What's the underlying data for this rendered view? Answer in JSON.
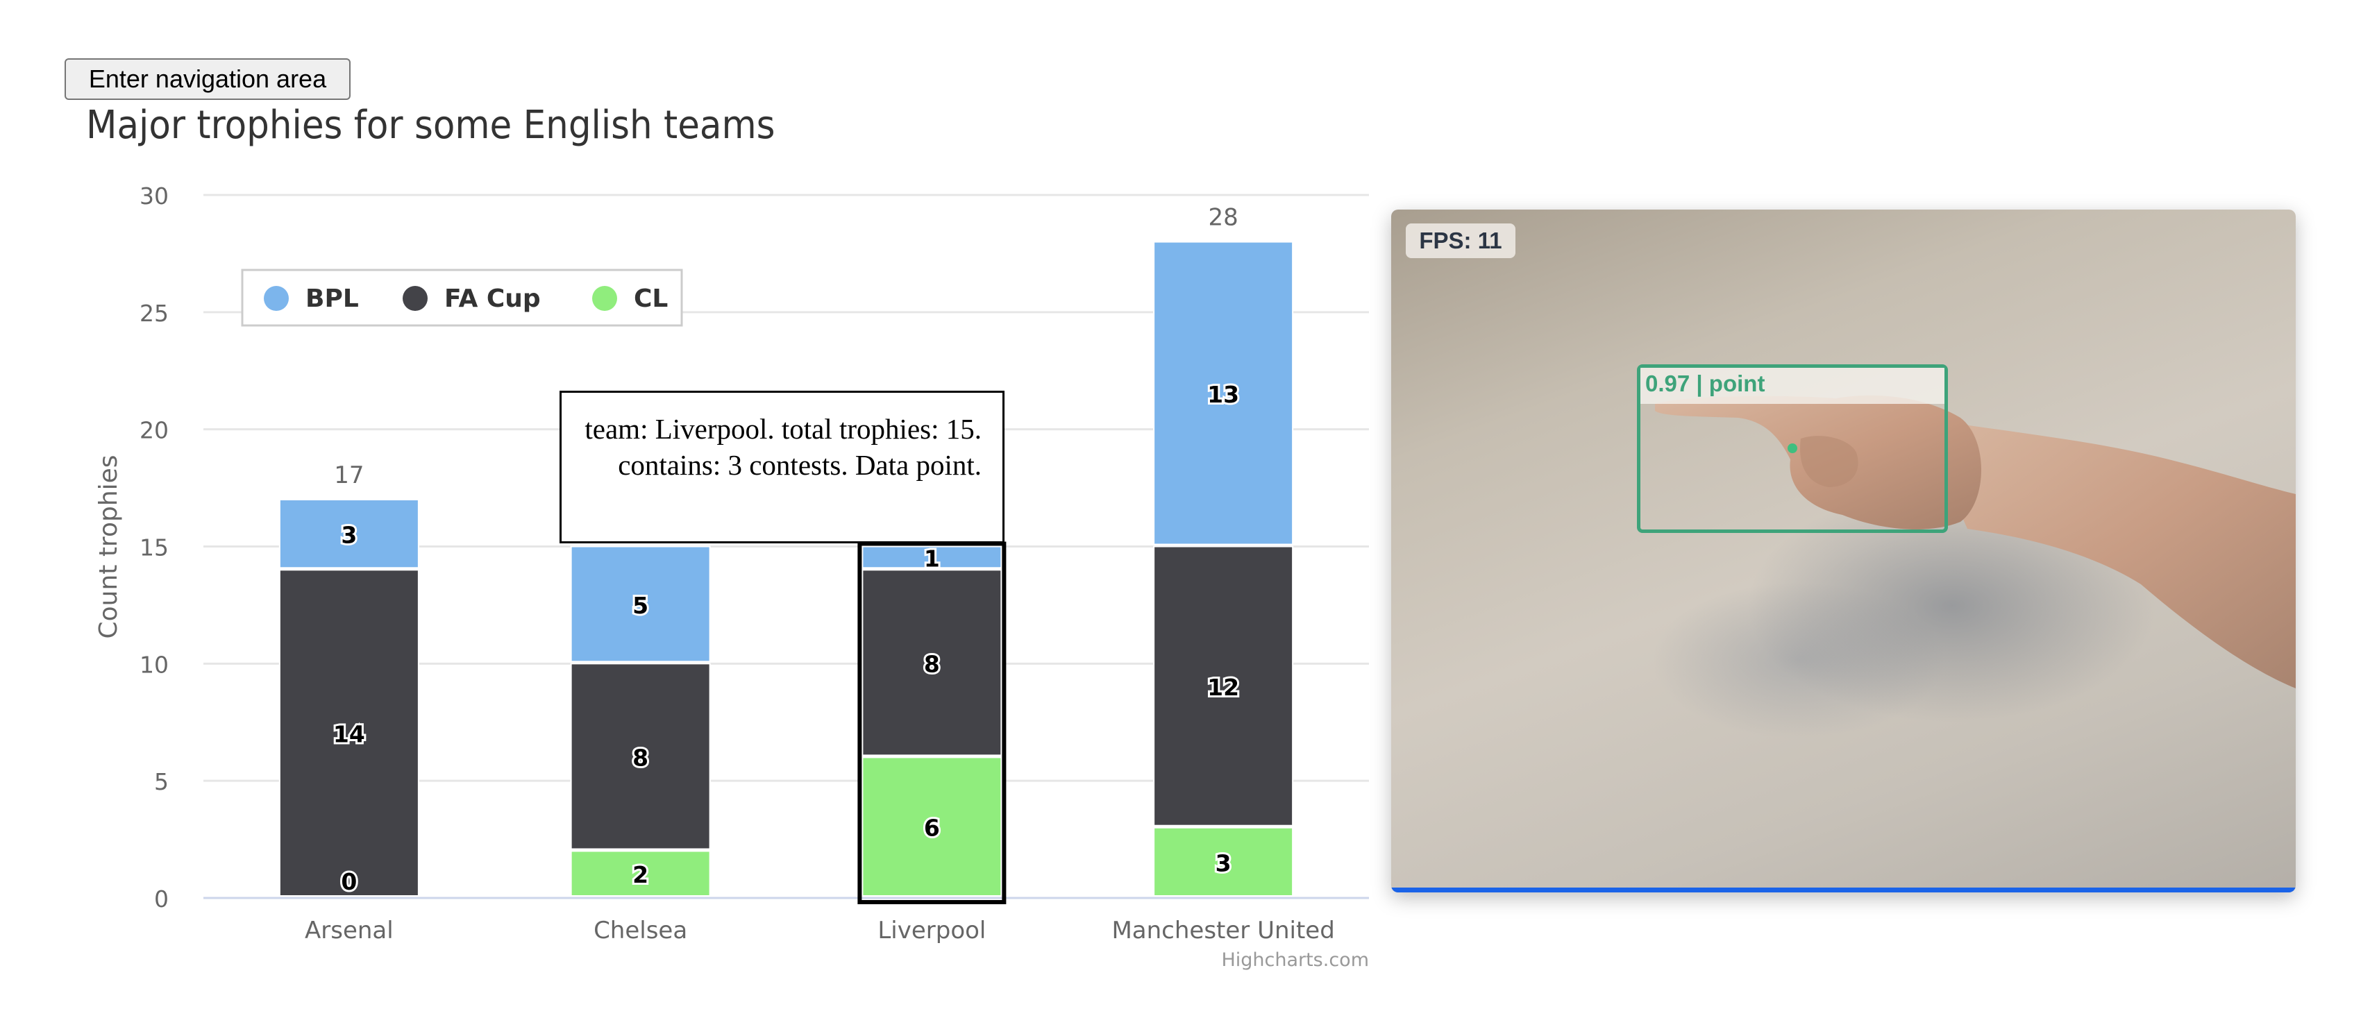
{
  "nav_button": {
    "label": "Enter navigation area"
  },
  "chart_data": {
    "type": "bar",
    "stacked": true,
    "title": "Major trophies for some English teams",
    "xlabel": "",
    "ylabel": "Count trophies",
    "ylim": [
      0,
      30
    ],
    "yticks": [
      0,
      5,
      10,
      15,
      20,
      25,
      30
    ],
    "grid": true,
    "legend_position": "top-left",
    "categories": [
      "Arsenal",
      "Chelsea",
      "Liverpool",
      "Manchester United"
    ],
    "series": [
      {
        "name": "BPL",
        "color": "#7cb5ec",
        "values": [
          3,
          5,
          1,
          13
        ]
      },
      {
        "name": "FA Cup",
        "color": "#434348",
        "values": [
          14,
          8,
          8,
          12
        ]
      },
      {
        "name": "CL",
        "color": "#90ed7d",
        "values": [
          0,
          2,
          6,
          3
        ]
      }
    ],
    "totals": [
      17,
      15,
      15,
      28
    ],
    "show_totals": [
      true,
      false,
      false,
      true
    ],
    "highlighted_category": "Liverpool",
    "credit": "Highcharts.com"
  },
  "tooltip": {
    "text": "team: Liverpool. total trophies: 15. contains: 3 contests. Data point."
  },
  "video": {
    "fps_label": "FPS: 11",
    "detection_label": "0.97 | point",
    "detection_confidence": 0.97,
    "detection_class": "point",
    "accent_color": "#3ea37a",
    "bar_color": "#1a63e8"
  }
}
